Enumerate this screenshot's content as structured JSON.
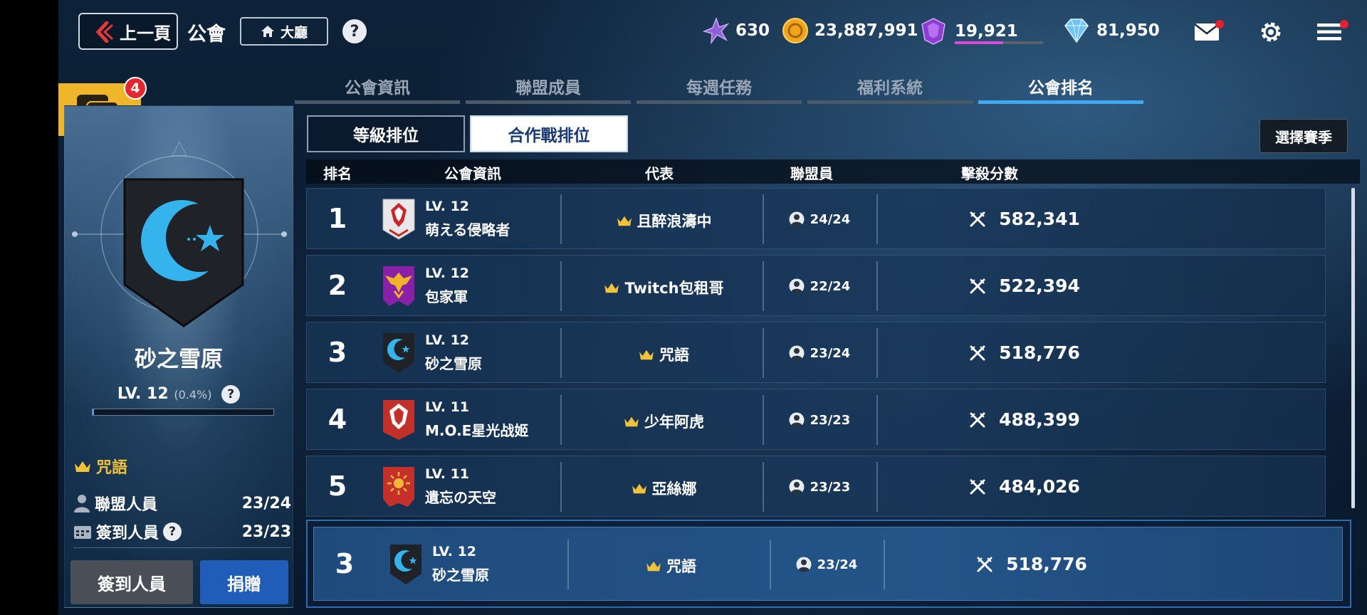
{
  "header": {
    "back_label": "上一頁",
    "title": "公會",
    "lobby_label": "大廳",
    "help": "?"
  },
  "resources": [
    {
      "icon": "purple-crystal-icon",
      "value": "630"
    },
    {
      "icon": "gold-coin-icon",
      "value": "23,887,991"
    },
    {
      "icon": "purple-gem-icon",
      "value": "19,921",
      "bar_fraction": 0.55
    },
    {
      "icon": "diamond-icon",
      "value": "81,950"
    }
  ],
  "tabs": [
    "公會資訊",
    "聯盟成員",
    "每週任務",
    "福利系統",
    "公會排名"
  ],
  "active_tab": "公會排名",
  "subtabs": {
    "level": "等級排位",
    "coop": "合作戰排位",
    "active": "合作戰排位"
  },
  "season_button": "選擇賽季",
  "table_headers": {
    "rank": "排名",
    "guild": "公會資訊",
    "rep": "代表",
    "members": "聯盟員",
    "score": "擊殺分數"
  },
  "rows": [
    {
      "rank": "1",
      "lv": "LV. 12",
      "name": "萌える侵略者",
      "rep": "且醉浪濤中",
      "members": "24/24",
      "score": "582,341",
      "emblem": "white-red-emblem"
    },
    {
      "rank": "2",
      "lv": "LV. 12",
      "name": "包家軍",
      "rep": "Twitch包租哥",
      "members": "22/24",
      "score": "522,394",
      "emblem": "purple-eagle-emblem"
    },
    {
      "rank": "3",
      "lv": "LV. 12",
      "name": "砂之雪原",
      "rep": "咒語",
      "members": "23/24",
      "score": "518,776",
      "emblem": "moon-star-emblem"
    },
    {
      "rank": "4",
      "lv": "LV. 11",
      "name": "M.O.E星光战姬",
      "rep": "少年阿虎",
      "members": "23/23",
      "score": "488,399",
      "emblem": "red-white-emblem"
    },
    {
      "rank": "5",
      "lv": "LV. 11",
      "name": "遺忘の天空",
      "rep": "亞絲娜",
      "members": "23/23",
      "score": "484,026",
      "emblem": "red-sun-emblem"
    }
  ],
  "my_guild_row": {
    "rank": "3",
    "lv": "LV. 12",
    "name": "砂之雪原",
    "rep": "咒語",
    "members": "23/24",
    "score": "518,776"
  },
  "guild": {
    "name": "砂之雪原",
    "level": "LV. 12",
    "exp_pct": "(0.4%)",
    "exp_fraction": 0.004,
    "leader": "咒語",
    "members_label": "聯盟人員",
    "members_value": "23/24",
    "checkin_label": "簽到人員",
    "checkin_value": "23/23",
    "checkin_button": "簽到人員",
    "donate_button": "捐贈"
  },
  "chat_badge": "4",
  "colors": {
    "accent_blue": "#3fa8f0",
    "gold": "#f2c33a",
    "donate_button": "#1f5db8",
    "checkin_button": "#4a4f57"
  }
}
